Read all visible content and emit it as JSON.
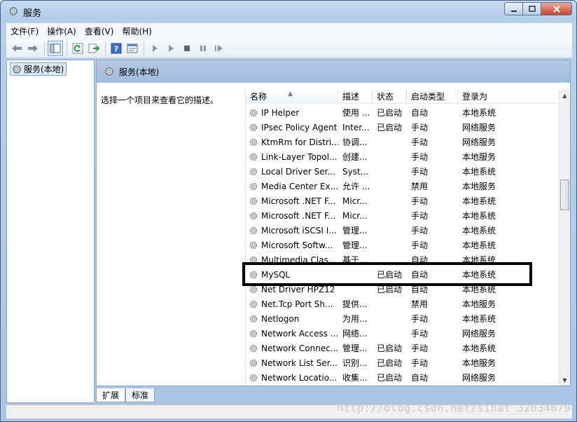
{
  "window": {
    "title": "服务"
  },
  "menu": [
    "文件(F)",
    "操作(A)",
    "查看(V)",
    "帮助(H)"
  ],
  "toolbar": {
    "icons": [
      "back-arrow-icon",
      "forward-arrow-icon",
      "show-hide-tree-icon",
      "refresh-icon",
      "export-list-icon",
      "help-icon",
      "properties-icon",
      "start-service-icon",
      "start-service-alt-icon",
      "stop-service-icon",
      "pause-service-icon",
      "restart-service-icon"
    ]
  },
  "tree": {
    "root_label": "服务(本地)"
  },
  "content": {
    "header_title": "服务(本地)",
    "description_hint": "选择一个项目来查看它的描述。"
  },
  "columns": {
    "name": "名称",
    "desc": "描述",
    "state": "状态",
    "startup": "启动类型",
    "logon": "登录为"
  },
  "services": [
    {
      "name": "IP Helper",
      "desc": "使用 ...",
      "state": "已启动",
      "startup": "自动",
      "logon": "本地系统"
    },
    {
      "name": "IPsec Policy Agent",
      "desc": "Inter...",
      "state": "已启动",
      "startup": "手动",
      "logon": "网络服务"
    },
    {
      "name": "KtmRm for Distri...",
      "desc": "协调...",
      "state": "",
      "startup": "手动",
      "logon": "网络服务"
    },
    {
      "name": "Link-Layer Topol...",
      "desc": "创建...",
      "state": "",
      "startup": "手动",
      "logon": "本地服务"
    },
    {
      "name": "Local Driver Ser...",
      "desc": "Syst...",
      "state": "",
      "startup": "手动",
      "logon": "本地系统"
    },
    {
      "name": "Media Center Ex...",
      "desc": "允许 ...",
      "state": "",
      "startup": "禁用",
      "logon": "本地服务"
    },
    {
      "name": "Microsoft .NET F...",
      "desc": "Micr...",
      "state": "",
      "startup": "手动",
      "logon": "本地系统"
    },
    {
      "name": "Microsoft .NET F...",
      "desc": "Micr...",
      "state": "",
      "startup": "手动",
      "logon": "本地系统"
    },
    {
      "name": "Microsoft iSCSI I...",
      "desc": "管理...",
      "state": "",
      "startup": "手动",
      "logon": "本地系统"
    },
    {
      "name": "Microsoft Softw...",
      "desc": "管理...",
      "state": "",
      "startup": "手动",
      "logon": "本地系统"
    },
    {
      "name": "Multimedia Clas...",
      "desc": "基于...",
      "state": "",
      "startup": "自动",
      "logon": "本地系统"
    },
    {
      "name": "MySQL",
      "desc": "",
      "state": "已启动",
      "startup": "自动",
      "logon": "本地系统"
    },
    {
      "name": "Net Driver HPZ12",
      "desc": "",
      "state": "已启动",
      "startup": "自动",
      "logon": "本地系统"
    },
    {
      "name": "Net.Tcp Port Sh...",
      "desc": "提供...",
      "state": "",
      "startup": "禁用",
      "logon": "本地服务"
    },
    {
      "name": "Netlogon",
      "desc": "为用...",
      "state": "",
      "startup": "手动",
      "logon": "本地系统"
    },
    {
      "name": "Network Access ...",
      "desc": "网络...",
      "state": "",
      "startup": "手动",
      "logon": "网络服务"
    },
    {
      "name": "Network Connec...",
      "desc": "管理...",
      "state": "已启动",
      "startup": "手动",
      "logon": "本地系统"
    },
    {
      "name": "Network List Ser...",
      "desc": "识别...",
      "state": "已启动",
      "startup": "手动",
      "logon": "本地服务"
    },
    {
      "name": "Network Locatio...",
      "desc": "收集...",
      "state": "已启动",
      "startup": "自动",
      "logon": "网络服务"
    }
  ],
  "highlighted_service": "MySQL",
  "tabs": [
    "扩展",
    "标准"
  ],
  "active_tab": "扩展",
  "watermark": "http://blog.csdn.net/sinat_32034679",
  "colors": {
    "highlight_border": "#000000",
    "header_band": "#a9c2e2"
  }
}
